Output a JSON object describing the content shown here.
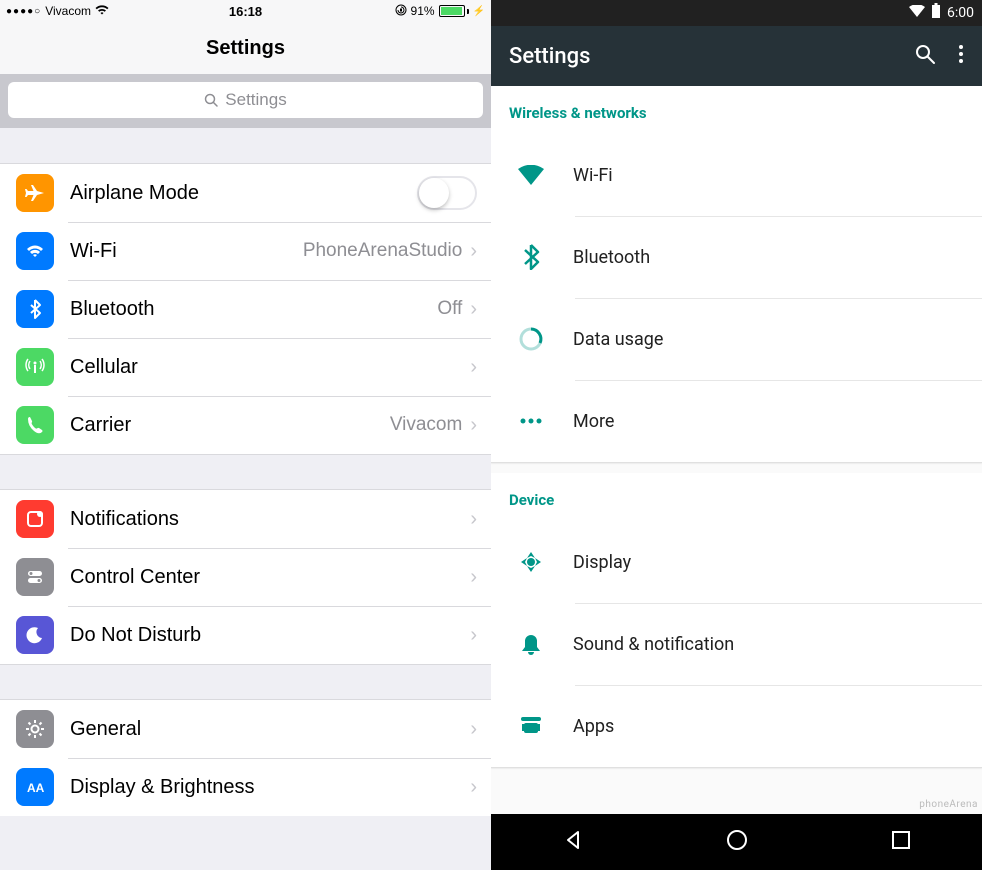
{
  "ios": {
    "statusbar": {
      "signal_dots": "●●●●○",
      "carrier": "Vivacom",
      "time": "16:18",
      "battery_pct": "91%",
      "charging_glyph": "⚡"
    },
    "header": {
      "title": "Settings"
    },
    "search": {
      "placeholder": "Settings"
    },
    "group1": [
      {
        "icon_bg": "#ff9500",
        "icon_name": "airplane-icon",
        "label": "Airplane Mode",
        "type": "toggle",
        "on": false
      },
      {
        "icon_bg": "#007aff",
        "icon_name": "wifi-icon",
        "label": "Wi-Fi",
        "value": "PhoneArenaStudio",
        "type": "link"
      },
      {
        "icon_bg": "#007aff",
        "icon_name": "bluetooth-icon",
        "label": "Bluetooth",
        "value": "Off",
        "type": "link"
      },
      {
        "icon_bg": "#4cd964",
        "icon_name": "cellular-icon",
        "label": "Cellular",
        "value": "",
        "type": "link"
      },
      {
        "icon_bg": "#4cd964",
        "icon_name": "phone-icon",
        "label": "Carrier",
        "value": "Vivacom",
        "type": "link"
      }
    ],
    "group2": [
      {
        "icon_bg": "#ff3b30",
        "icon_name": "notifications-icon",
        "label": "Notifications",
        "type": "link"
      },
      {
        "icon_bg": "#8e8e93",
        "icon_name": "control-center-icon",
        "label": "Control Center",
        "type": "link"
      },
      {
        "icon_bg": "#5856d6",
        "icon_name": "moon-icon",
        "label": "Do Not Disturb",
        "type": "link"
      }
    ],
    "group3": [
      {
        "icon_bg": "#8e8e93",
        "icon_name": "gear-icon",
        "label": "General",
        "type": "link"
      },
      {
        "icon_bg": "#007aff",
        "icon_name": "display-brightness-icon",
        "label": "Display & Brightness",
        "type": "link"
      }
    ]
  },
  "android": {
    "statusbar": {
      "time": "6:00"
    },
    "appbar": {
      "title": "Settings"
    },
    "sections": [
      {
        "header": "Wireless & networks",
        "rows": [
          {
            "icon_name": "wifi-icon",
            "label": "Wi-Fi"
          },
          {
            "icon_name": "bluetooth-icon",
            "label": "Bluetooth"
          },
          {
            "icon_name": "data-usage-icon",
            "label": "Data usage"
          },
          {
            "icon_name": "more-icon",
            "label": "More"
          }
        ]
      },
      {
        "header": "Device",
        "rows": [
          {
            "icon_name": "display-icon",
            "label": "Display"
          },
          {
            "icon_name": "sound-notification-icon",
            "label": "Sound & notification"
          },
          {
            "icon_name": "apps-icon",
            "label": "Apps"
          }
        ]
      }
    ],
    "watermark": "phoneArena"
  },
  "colors": {
    "ios_bg": "#efeff4",
    "android_accent": "#009688",
    "android_appbar": "#263238"
  }
}
